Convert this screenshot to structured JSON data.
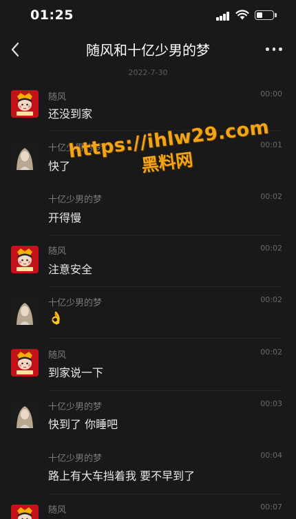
{
  "status_bar": {
    "time": "01:25",
    "battery_level": 0.35
  },
  "header": {
    "title": "随风和十亿少男的梦"
  },
  "date_divider": "2022-7-30",
  "messages": [
    {
      "sender": "随风",
      "time": "00:00",
      "text": "还没到家",
      "avatar": "red-tiger-avatar"
    },
    {
      "sender": "十亿少男的梦",
      "time": "00:01",
      "text": "快了",
      "avatar": "girl-photo-avatar"
    },
    {
      "sender": "十亿少男的梦",
      "time": "00:02",
      "text": "开得慢",
      "avatar": "none"
    },
    {
      "sender": "随风",
      "time": "00:02",
      "text": "注意安全",
      "avatar": "red-tiger-avatar"
    },
    {
      "sender": "十亿少男的梦",
      "time": "00:02",
      "text": "👌",
      "avatar": "girl-photo-avatar"
    },
    {
      "sender": "随风",
      "time": "00:02",
      "text": "到家说一下",
      "avatar": "red-tiger-avatar"
    },
    {
      "sender": "十亿少男的梦",
      "time": "00:03",
      "text": "快到了 你睡吧",
      "avatar": "girl-photo-avatar"
    },
    {
      "sender": "十亿少男的梦",
      "time": "00:04",
      "text": "路上有大车挡着我 要不早到了",
      "avatar": "none"
    },
    {
      "sender": "随风",
      "time": "00:07",
      "text": "",
      "avatar": "red-tiger-avatar"
    }
  ],
  "watermark": {
    "url": "https://ihlw29.com",
    "name": "黑料网"
  }
}
